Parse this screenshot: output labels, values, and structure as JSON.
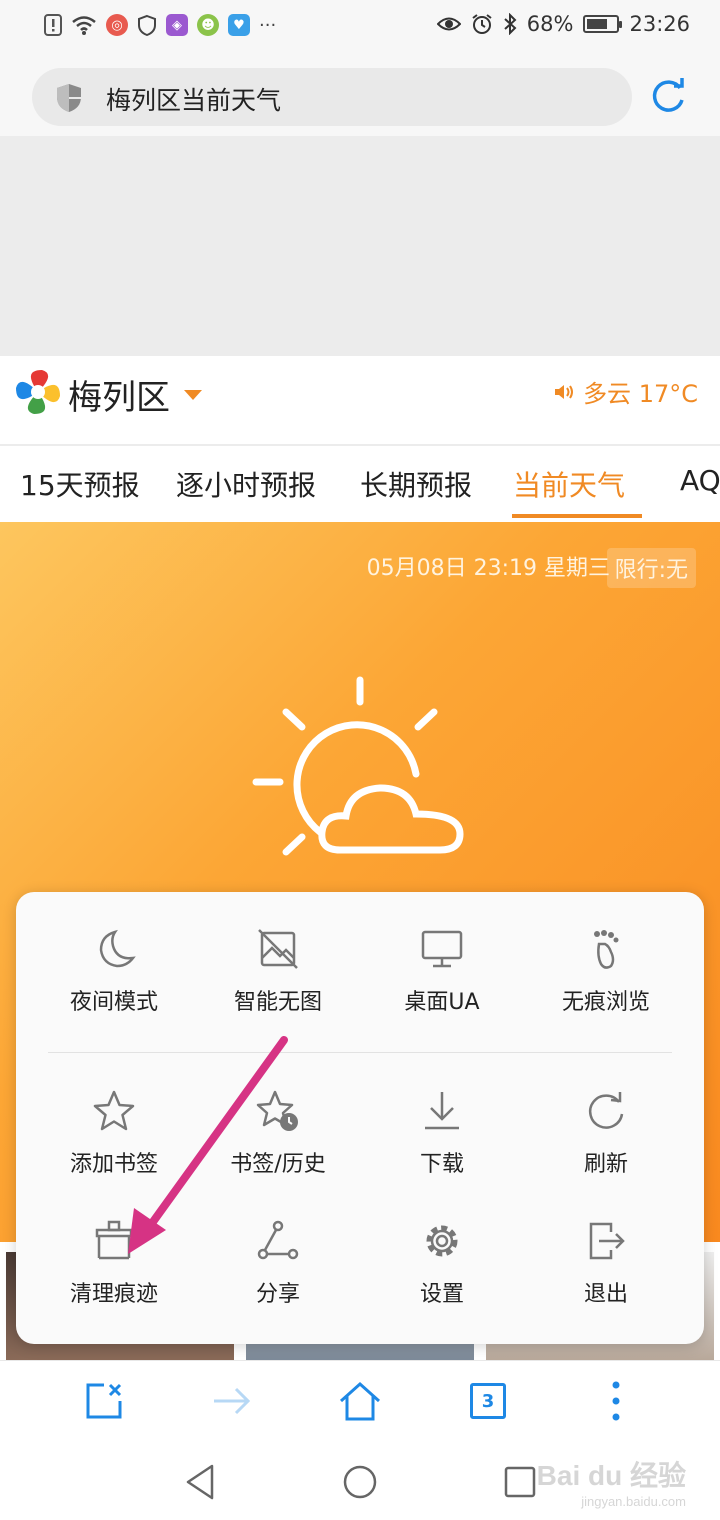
{
  "status_bar": {
    "battery_percent": "68%",
    "battery_level": 0.68,
    "time": "23:26",
    "more": "···"
  },
  "address_bar": {
    "url_text": "梅列区当前天气"
  },
  "city_header": {
    "city": "梅列区",
    "weather_summary": "多云 17°C"
  },
  "tabs": [
    {
      "label": "15天预报",
      "active": false
    },
    {
      "label": "逐小时预报",
      "active": false
    },
    {
      "label": "长期预报",
      "active": false
    },
    {
      "label": "当前天气",
      "active": true
    },
    {
      "label": "AQ",
      "active": false
    }
  ],
  "hero": {
    "datetime": "05月08日 23:19 星期三",
    "traffic_limit": "限行:无"
  },
  "menu": {
    "items": [
      {
        "label": "夜间模式",
        "icon": "moon-icon"
      },
      {
        "label": "智能无图",
        "icon": "no-image-icon"
      },
      {
        "label": "桌面UA",
        "icon": "monitor-icon"
      },
      {
        "label": "无痕浏览",
        "icon": "footprint-icon"
      },
      {
        "label": "添加书签",
        "icon": "star-icon"
      },
      {
        "label": "书签/历史",
        "icon": "star-clock-icon"
      },
      {
        "label": "下载",
        "icon": "download-icon"
      },
      {
        "label": "刷新",
        "icon": "refresh-icon"
      },
      {
        "label": "清理痕迹",
        "icon": "broom-icon"
      },
      {
        "label": "分享",
        "icon": "share-icon"
      },
      {
        "label": "设置",
        "icon": "gear-icon"
      },
      {
        "label": "退出",
        "icon": "exit-icon"
      }
    ]
  },
  "toolbar": {
    "tab_count": "3"
  },
  "watermark": {
    "main": "Bai du 经验",
    "sub": "jingyan.baidu.com"
  },
  "colors": {
    "accent_orange": "#f08a24",
    "accent_blue": "#1e88e5",
    "annotation_arrow": "#d63384"
  }
}
